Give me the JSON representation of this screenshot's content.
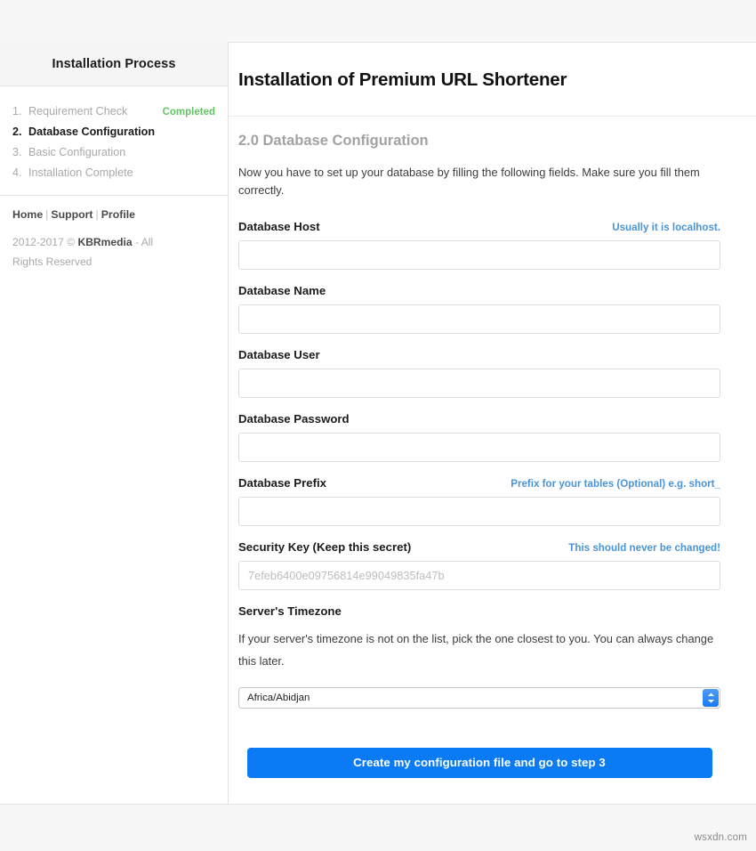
{
  "page": {
    "background_color": "#f7f7f7",
    "watermark": "wsxdn.com"
  },
  "sidebar": {
    "header_title": "Installation Process",
    "steps": [
      {
        "num": "1.",
        "label": "Requirement Check",
        "badge": "Completed",
        "active": false
      },
      {
        "num": "2.",
        "label": "Database Configuration",
        "badge": "",
        "active": true
      },
      {
        "num": "3.",
        "label": "Basic Configuration",
        "badge": "",
        "active": false
      },
      {
        "num": "4.",
        "label": "Installation Complete",
        "badge": "",
        "active": false
      }
    ],
    "links": {
      "home": "Home",
      "support": "Support",
      "profile": "Profile",
      "separator": "|"
    },
    "copyright": {
      "prefix": "2012-2017 © ",
      "brand": "KBRmedia",
      "suffix": " - All Rights Reserved"
    }
  },
  "main": {
    "title": "Installation of Premium URL Shortener",
    "section_title": "2.0 Database Configuration",
    "intro": "Now you have to set up your database by filling the following fields. Make sure you fill them correctly.",
    "fields": [
      {
        "label": "Database Host",
        "hint": "Usually it is localhost.",
        "value": "",
        "placeholder": "",
        "name": "database-host"
      },
      {
        "label": "Database Name",
        "hint": "",
        "value": "",
        "placeholder": "",
        "name": "database-name"
      },
      {
        "label": "Database User",
        "hint": "",
        "value": "",
        "placeholder": "",
        "name": "database-user"
      },
      {
        "label": "Database Password",
        "hint": "",
        "value": "",
        "placeholder": "",
        "name": "database-password"
      },
      {
        "label": "Database Prefix",
        "hint": "Prefix for your tables (Optional) e.g. short_",
        "value": "",
        "placeholder": "",
        "name": "database-prefix"
      },
      {
        "label": "Security Key (Keep this secret)",
        "hint": "This should never be changed!",
        "value": "7efeb6400e09756814e99049835fa47b",
        "placeholder": "",
        "name": "security-key"
      }
    ],
    "timezone": {
      "label": "Server's Timezone",
      "note": "If your server's timezone is not on the list, pick the one closest to you. You can always change this later.",
      "selected": "Africa/Abidjan"
    },
    "submit_label": "Create my configuration file and go to step 3"
  },
  "colors": {
    "accent_blue": "#0b7bf5",
    "hint_blue": "#4b95d6",
    "success_green": "#62c462",
    "muted_gray": "#a9a9a9"
  }
}
